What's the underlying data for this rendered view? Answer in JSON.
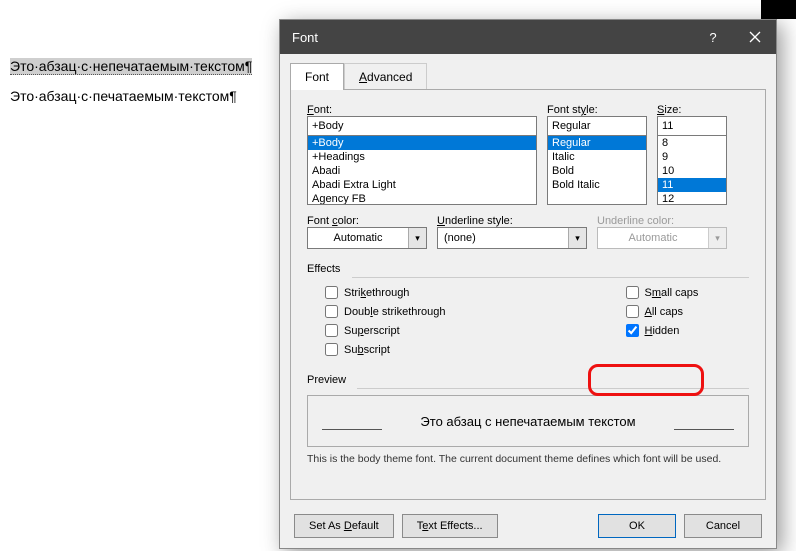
{
  "doc": {
    "line1": "Это·абзац·с·непечатаемым·текстом¶",
    "line2": "Это·абзац·с·печатаемым·текстом¶"
  },
  "dialog": {
    "title": "Font",
    "tabs": {
      "font": "Font",
      "advanced": "Advanced"
    },
    "labels": {
      "font": "Font:",
      "style": "Font style:",
      "size": "Size:",
      "color": "Font color:",
      "underline_style": "Underline style:",
      "underline_color": "Underline color:",
      "effects": "Effects",
      "preview": "Preview"
    },
    "font_value": "+Body",
    "font_list": [
      "+Body",
      "+Headings",
      "Abadi",
      "Abadi Extra Light",
      "Agency FB"
    ],
    "style_value": "Regular",
    "style_list": [
      "Regular",
      "Italic",
      "Bold",
      "Bold Italic"
    ],
    "size_value": "11",
    "size_list": [
      "8",
      "9",
      "10",
      "11",
      "12"
    ],
    "font_color": "Automatic",
    "underline_style": "(none)",
    "underline_color": "Automatic",
    "effects_left": {
      "strike": "Strikethrough",
      "dstrike": "Double strikethrough",
      "super": "Superscript",
      "sub": "Subscript"
    },
    "effects_right": {
      "smallcaps": "Small caps",
      "allcaps": "All caps",
      "hidden": "Hidden"
    },
    "preview_text": "Это абзац с непечатаемым текстом",
    "desc": "This is the body theme font. The current document theme defines which font will be used.",
    "buttons": {
      "set_default": "Set As Default",
      "text_effects": "Text Effects...",
      "ok": "OK",
      "cancel": "Cancel"
    }
  }
}
